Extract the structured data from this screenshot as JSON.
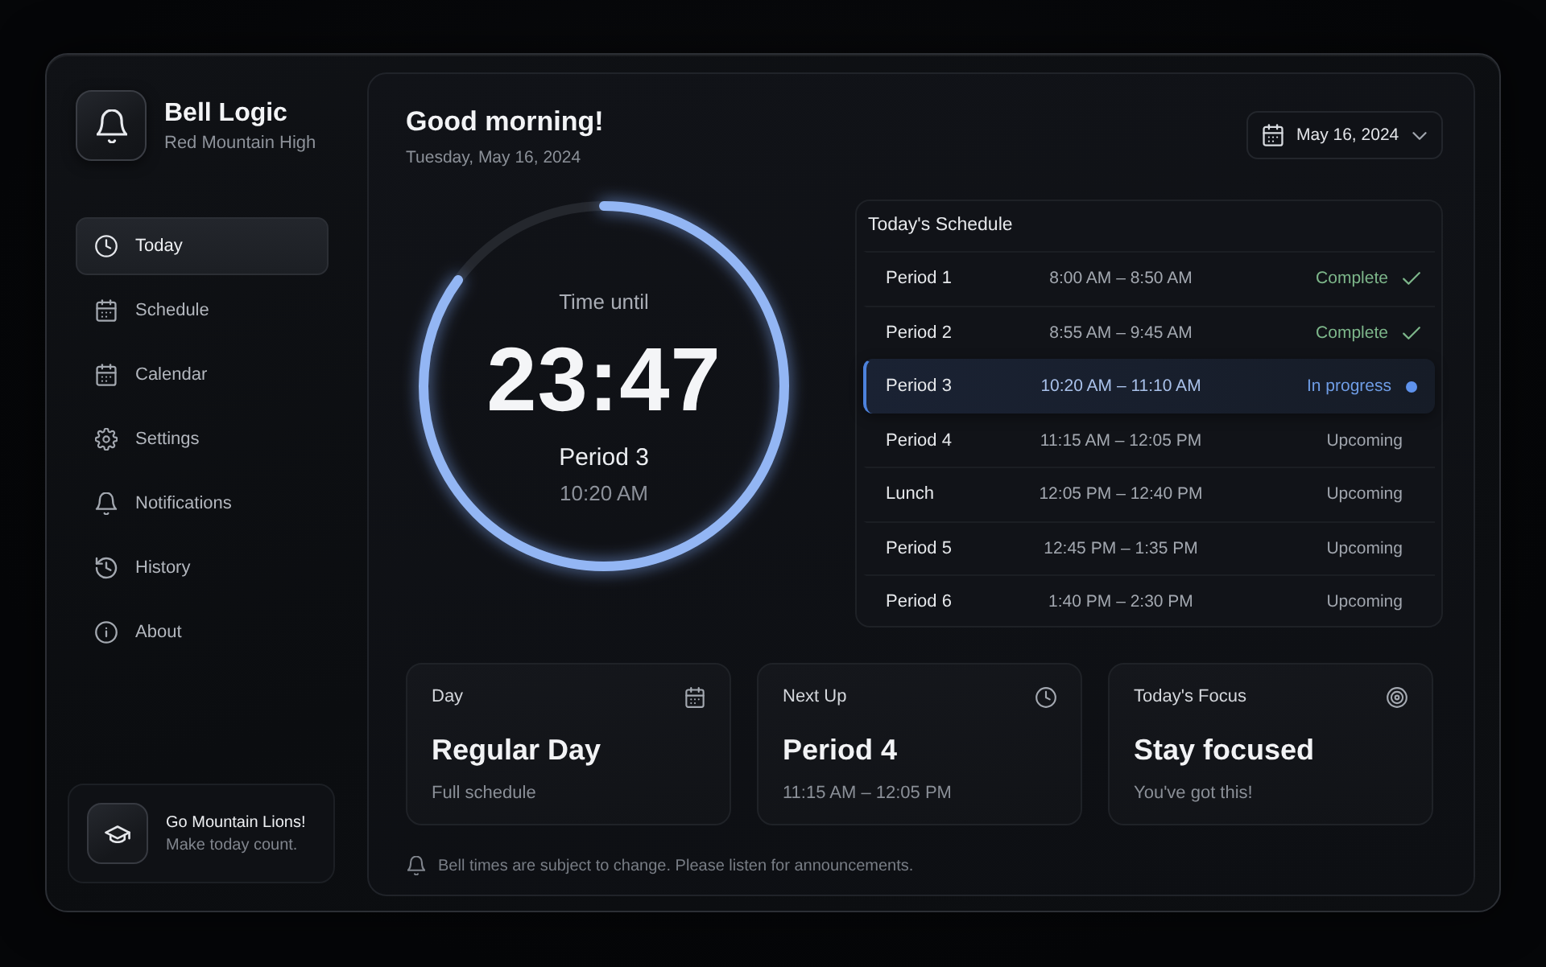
{
  "app": {
    "name": "Bell Logic",
    "school": "Red Mountain High"
  },
  "sidebar": {
    "items": [
      {
        "label": "Today",
        "selected": true
      },
      {
        "label": "Schedule",
        "selected": false
      },
      {
        "label": "Calendar",
        "selected": false
      },
      {
        "label": "Settings",
        "selected": false
      },
      {
        "label": "Notifications",
        "selected": false
      },
      {
        "label": "History",
        "selected": false
      },
      {
        "label": "About",
        "selected": false
      }
    ],
    "footer_card": {
      "title": "Go Mountain Lions!",
      "subtitle": "Make today count."
    }
  },
  "header": {
    "greeting": "Good morning!",
    "date": "Tuesday, May 16, 2024"
  },
  "date_picker": {
    "value": "May 16, 2024"
  },
  "countdown": {
    "label": "Time until",
    "time": "23:47",
    "period": "Period 3",
    "start": "10:20 AM",
    "level": 0.85
  },
  "schedule": {
    "title": "Today's Schedule",
    "rows": [
      {
        "name": "Period 1",
        "time": "8:00 AM – 8:50 AM",
        "status": "Complete",
        "kind": "complete",
        "selected": false
      },
      {
        "name": "Period 2",
        "time": "8:55 AM – 9:45 AM",
        "status": "Complete",
        "kind": "complete",
        "selected": false
      },
      {
        "name": "Period 3",
        "time": "10:20 AM – 11:10 AM",
        "status": "In progress",
        "kind": "current",
        "selected": true
      },
      {
        "name": "Period 4",
        "time": "11:15 AM – 12:05 PM",
        "status": "Upcoming",
        "kind": "upcoming",
        "selected": false
      },
      {
        "name": "Lunch",
        "time": "12:05 PM – 12:40 PM",
        "status": "Upcoming",
        "kind": "upcoming",
        "selected": false
      },
      {
        "name": "Period 5",
        "time": "12:45 PM – 1:35 PM",
        "status": "Upcoming",
        "kind": "upcoming",
        "selected": false
      },
      {
        "name": "Period 6",
        "time": "1:40 PM – 2:30 PM",
        "status": "Upcoming",
        "kind": "upcoming",
        "selected": false
      }
    ]
  },
  "cards": [
    {
      "label": "Day",
      "value": "Regular Day",
      "subtitle": "Full schedule"
    },
    {
      "label": "Next Up",
      "value": "Period 4",
      "subtitle": "11:15 AM – 12:05 PM"
    },
    {
      "label": "Today's Focus",
      "value": "Stay focused",
      "subtitle": "You've got this!"
    }
  ],
  "notice": "Bell times are subject to change. Please listen for announcements."
}
